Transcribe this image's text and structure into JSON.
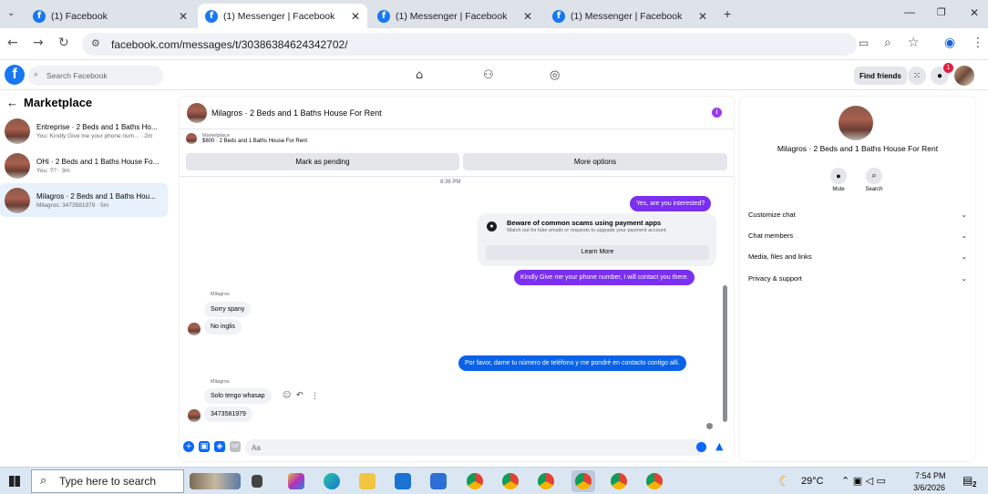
{
  "browser": {
    "tabs": [
      {
        "title": "(1) Facebook",
        "active": false
      },
      {
        "title": "(1) Messenger | Facebook",
        "active": true
      },
      {
        "title": "(1) Messenger | Facebook",
        "active": false
      },
      {
        "title": "(1) Messenger | Facebook",
        "active": false
      }
    ],
    "url": "facebook.com/messages/t/30386384624342702/"
  },
  "fb_header": {
    "search_placeholder": "Search Facebook",
    "find_friends": "Find friends",
    "notification_count": "1"
  },
  "left_panel": {
    "title": "Marketplace",
    "conversations": [
      {
        "title": "Entreprise · 2 Beds and 1 Baths Ho...",
        "snippet": "You: Kindly Give me your phone num... · 2m",
        "selected": false
      },
      {
        "title": "OHi · 2 Beds and 1 Baths House Fo...",
        "snippet": "You: ?? · 3m",
        "selected": false
      },
      {
        "title": "Milagros · 2 Beds and 1 Baths Hou...",
        "snippet": "Milagros: 3473581979 · 5m",
        "selected": true
      }
    ]
  },
  "chat": {
    "header_name": "Milagros · 2 Beds and 1 Baths House For Rent",
    "listing_label": "Marketplace",
    "listing_desc": "$800 · 2 Beds and 1 Baths House For Rent",
    "mark_pending": "Mark as pending",
    "more_options": "More options",
    "timestamp": "8:36 PM",
    "msg_out_1": "Yes, are you interested?",
    "warning_title": "Beware of common scams using payment apps",
    "warning_sub": "Watch out for fake emails or requests to upgrade your payment account.",
    "learn_more": "Learn More",
    "msg_out_2": "Kindly Give me your phone number, I will contact you there.",
    "sender_1": "Milagros",
    "msg_in_1": "Sorry spany",
    "msg_in_2": "No inglis",
    "msg_out_3": "Por favor, dame tu número de teléfono y me pondré en contacto contigo allí.",
    "sender_2": "Milagros",
    "msg_in_3": "Solo tengo whasap",
    "msg_in_4": "3473581979",
    "composer_placeholder": "Aa"
  },
  "right_panel": {
    "name": "Milagros · 2 Beds and 1 Baths House For Rent",
    "mute": "Mute",
    "search": "Search",
    "sections": [
      "Customize chat",
      "Chat members",
      "Media, files and links",
      "Privacy & support"
    ]
  },
  "taskbar": {
    "search_placeholder": "Type here to search",
    "weather": "29°C",
    "time": "7:54 PM",
    "date": "3/6/2026",
    "notif_count": "2"
  }
}
